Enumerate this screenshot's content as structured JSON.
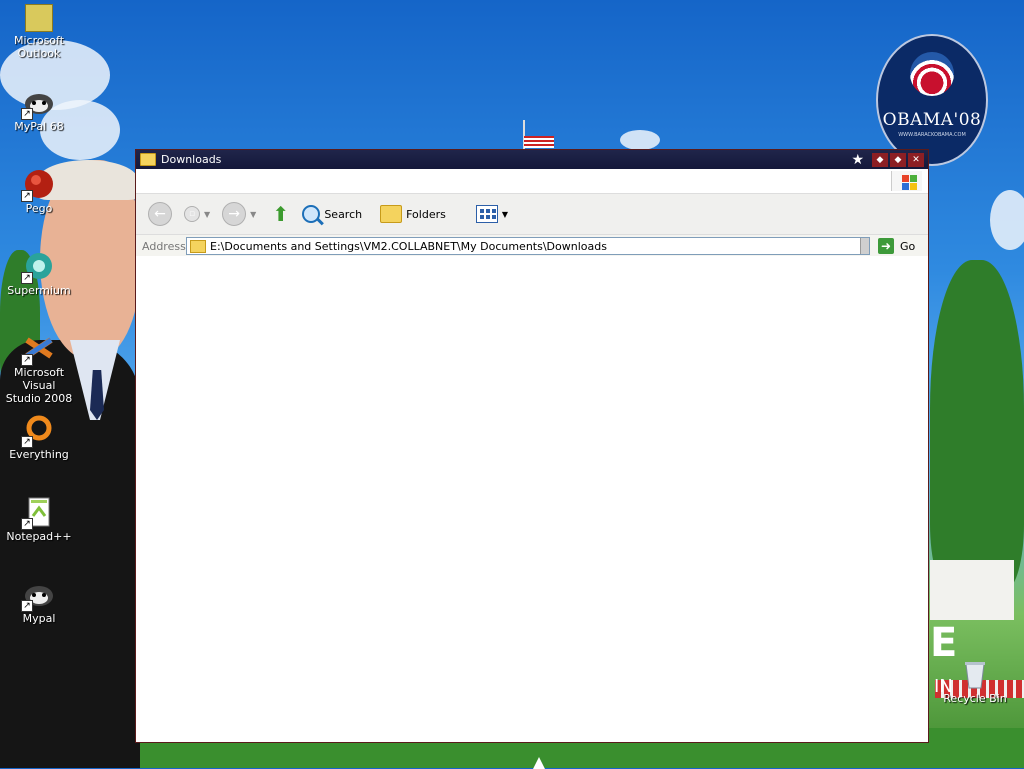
{
  "desktop": {
    "icons": [
      {
        "label": "Microsoft\nOutlook",
        "icon": "outlook-icon"
      },
      {
        "label": "MyPal 68",
        "icon": "mypal-icon"
      },
      {
        "label": "Pego",
        "icon": "pego-icon"
      },
      {
        "label": "Supermium",
        "icon": "supermium-icon"
      },
      {
        "label": "Microsoft Visual\nStudio 2008",
        "icon": "visual-studio-icon"
      },
      {
        "label": "Everything",
        "icon": "everything-icon"
      },
      {
        "label": "Notepad++",
        "icon": "notepadpp-icon"
      },
      {
        "label": "Mypal",
        "icon": "mypal-icon"
      },
      {
        "label": "Recycle Bin",
        "icon": "recycle-bin-icon"
      }
    ],
    "wallpaper": {
      "badge_text": "OBAMA'08",
      "badge_sub": "WWW.BARACKOBAMA.COM",
      "letters": "E",
      "letters2": "IN"
    }
  },
  "window": {
    "title": "Downloads",
    "toolbar": {
      "search_label": "Search",
      "folders_label": "Folders"
    },
    "address": {
      "label": "Address",
      "value": "E:\\Documents and Settings\\VM2.COLLABNET\\My Documents\\Downloads",
      "go_label": "Go"
    }
  },
  "colors": {
    "titlebar": "#1a1f42",
    "window_border": "#5a1b1b",
    "go_green": "#3d9a3a",
    "toolbar_bg": "#f0f0ee"
  }
}
